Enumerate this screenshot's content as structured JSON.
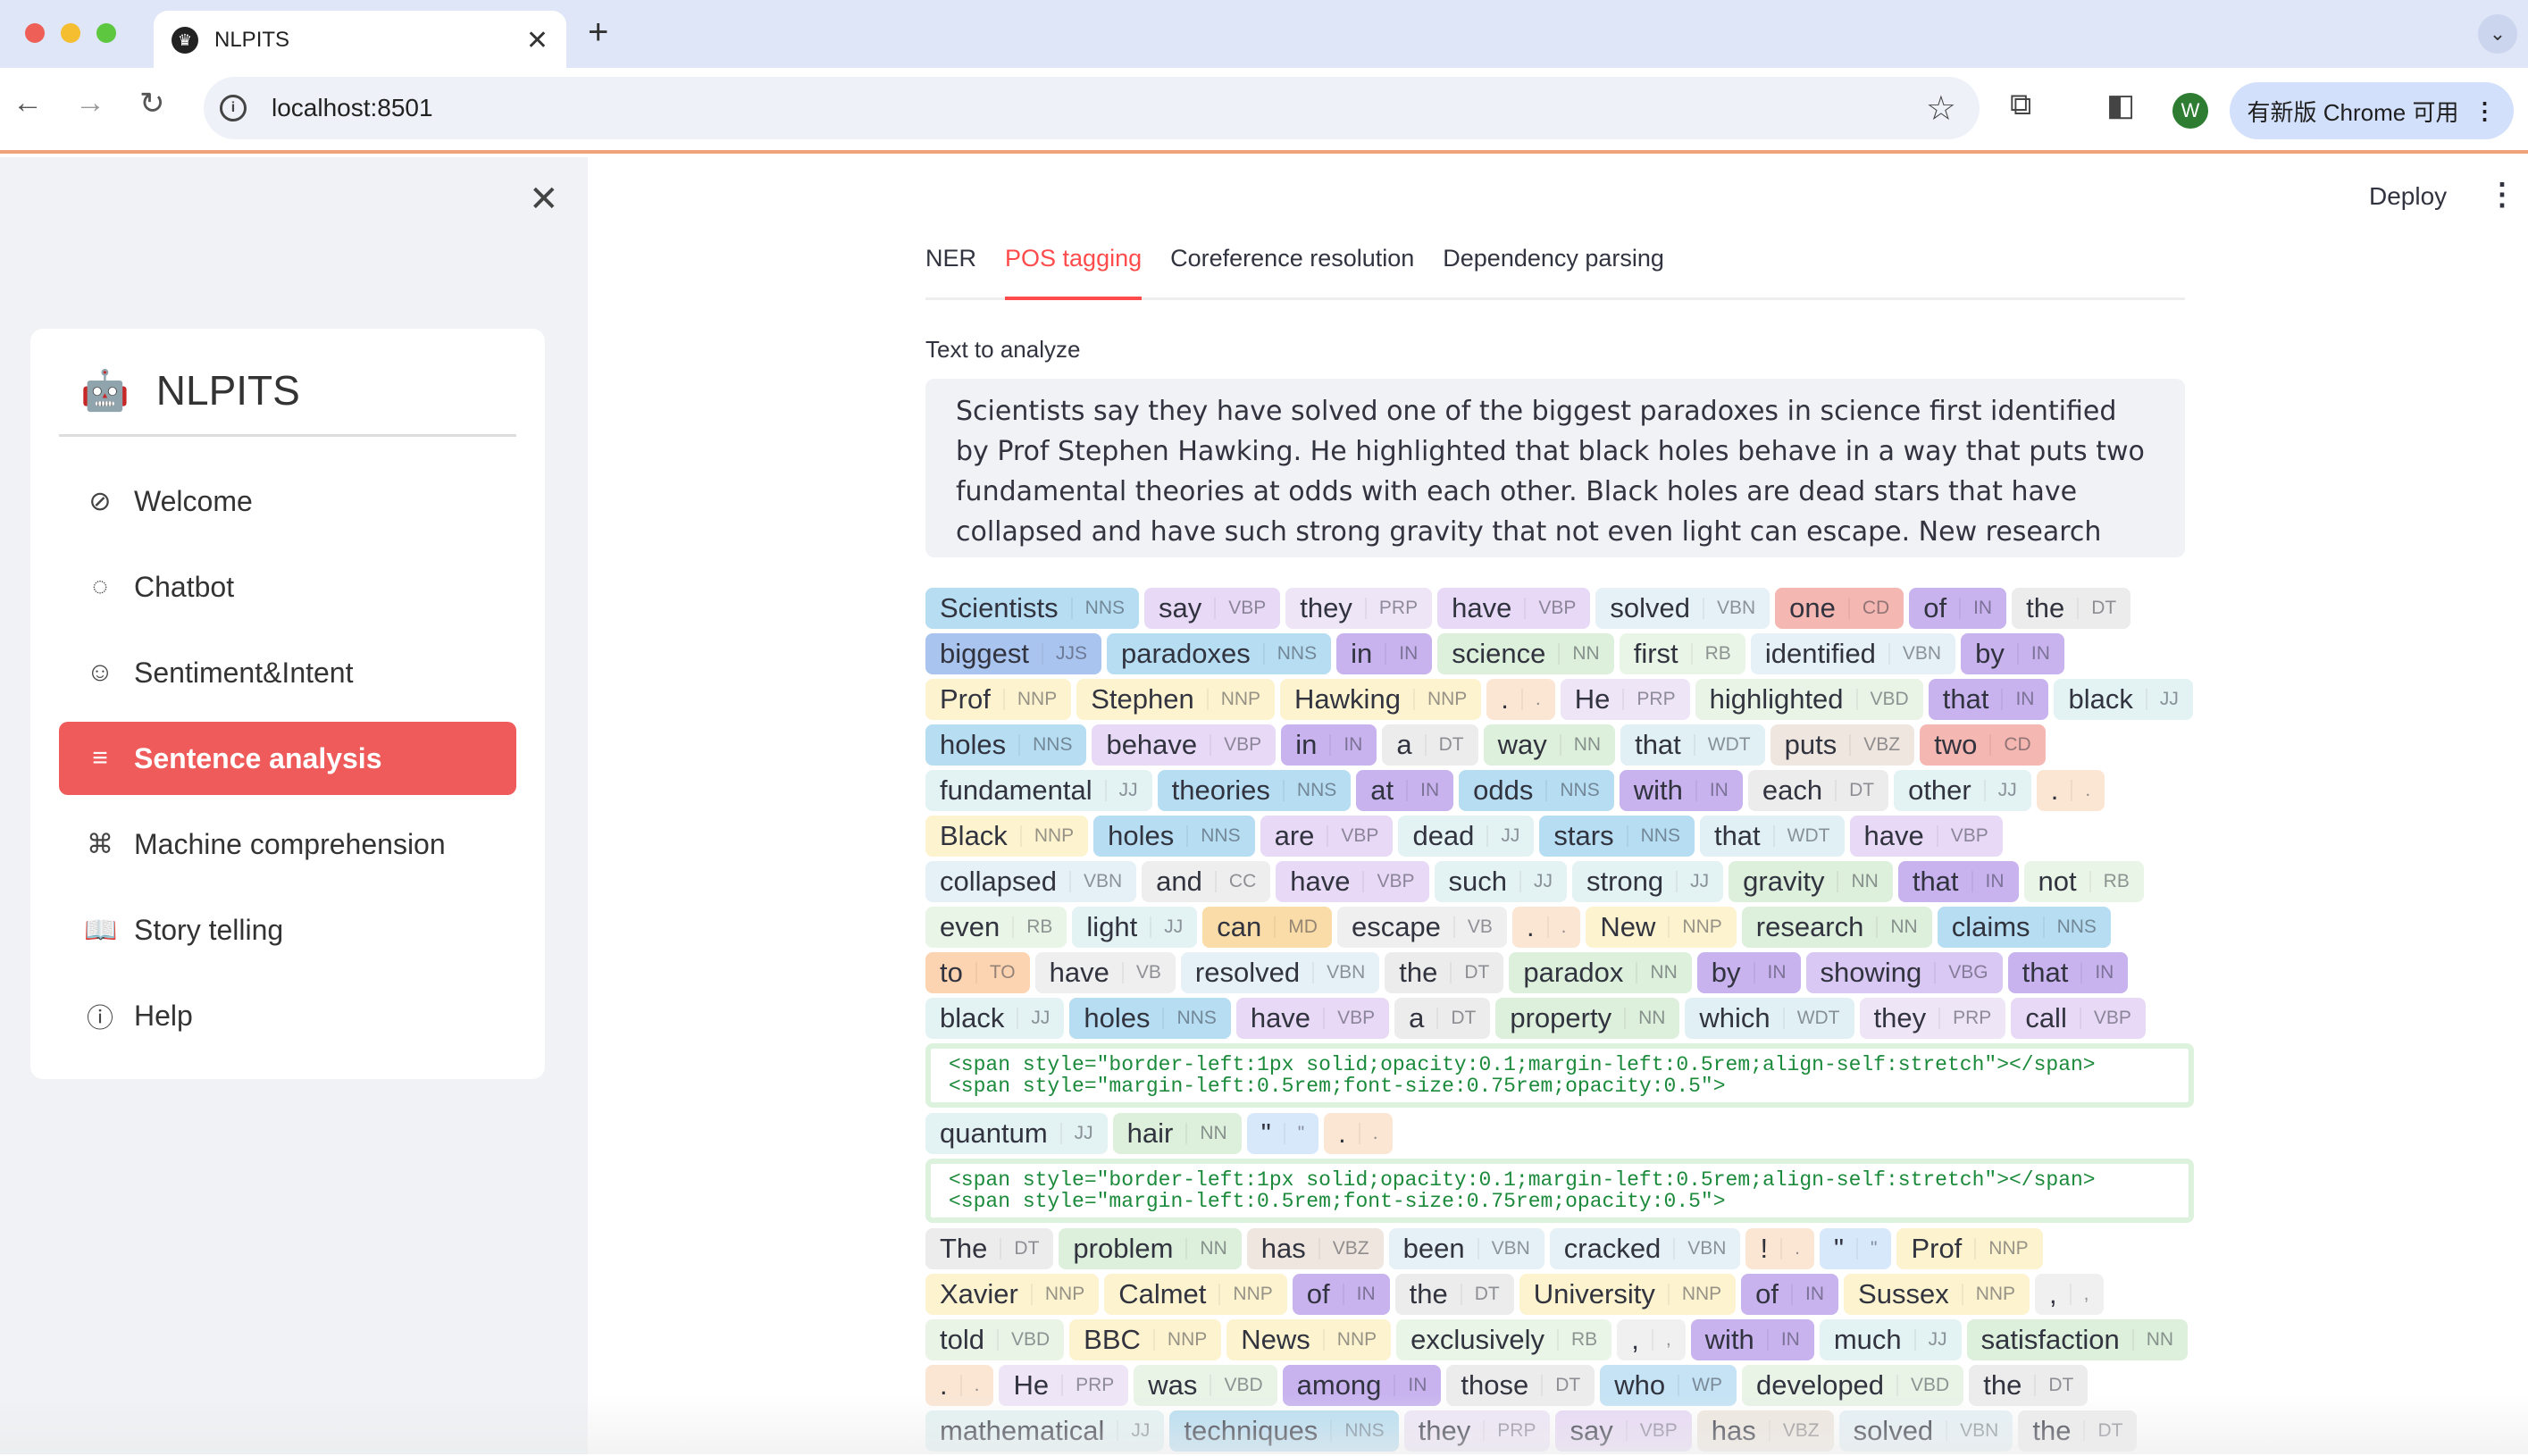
{
  "browser": {
    "tab_title": "NLPITS",
    "url": "localhost:8501",
    "update_label": "有新版 Chrome 可用",
    "avatar_letter": "W"
  },
  "app": {
    "deploy": "Deploy",
    "brand": "NLPITS",
    "menu": [
      {
        "label": "Welcome",
        "icon": "compass-icon"
      },
      {
        "label": "Chatbot",
        "icon": "chat-icon"
      },
      {
        "label": "Sentiment&Intent",
        "icon": "smile-icon"
      },
      {
        "label": "Sentence analysis",
        "icon": "list-icon",
        "active": true
      },
      {
        "label": "Machine comprehension",
        "icon": "translate-icon"
      },
      {
        "label": "Story telling",
        "icon": "book-icon"
      },
      {
        "label": "Help",
        "icon": "help-icon"
      }
    ],
    "tabs": [
      "NER",
      "POS tagging",
      "Coreference resolution",
      "Dependency parsing"
    ],
    "active_tab": "POS tagging",
    "text_label": "Text to analyze",
    "text_value": "Scientists say they have solved one of the biggest paradoxes in science first identified by Prof Stephen Hawking. He highlighted that black holes behave in a way that puts two fundamental theories at odds with each other. Black holes are dead stars that have collapsed and have such strong gravity that not even light can escape. New research claims to have resolved the paradox by",
    "code_block": "<span style=\"border-left:1px solid;opacity:0.1;margin-left:0.5rem;align-self:stretch\"></span>\n<span style=\"margin-left:0.5rem;font-size:0.75rem;opacity:0.5\">",
    "rows": [
      [
        [
          "Scientists",
          "NNS"
        ],
        [
          "say",
          "VBP"
        ],
        [
          "they",
          "PRP"
        ],
        [
          "have",
          "VBP"
        ],
        [
          "solved",
          "VBN"
        ],
        [
          "one",
          "CD"
        ],
        [
          "of",
          "IN"
        ],
        [
          "the",
          "DT"
        ]
      ],
      [
        [
          "biggest",
          "JJS"
        ],
        [
          "paradoxes",
          "NNS"
        ],
        [
          "in",
          "IN"
        ],
        [
          "science",
          "NN"
        ],
        [
          "first",
          "RB"
        ],
        [
          "identified",
          "VBN"
        ],
        [
          "by",
          "IN"
        ]
      ],
      [
        [
          "Prof",
          "NNP"
        ],
        [
          "Stephen",
          "NNP"
        ],
        [
          "Hawking",
          "NNP"
        ],
        [
          ".",
          "."
        ],
        [
          "He",
          "PRP"
        ],
        [
          "highlighted",
          "VBD"
        ],
        [
          "that",
          "IN"
        ],
        [
          "black",
          "JJ"
        ]
      ],
      [
        [
          "holes",
          "NNS"
        ],
        [
          "behave",
          "VBP"
        ],
        [
          "in",
          "IN"
        ],
        [
          "a",
          "DT"
        ],
        [
          "way",
          "NN"
        ],
        [
          "that",
          "WDT"
        ],
        [
          "puts",
          "VBZ"
        ],
        [
          "two",
          "CD"
        ]
      ],
      [
        [
          "fundamental",
          "JJ"
        ],
        [
          "theories",
          "NNS"
        ],
        [
          "at",
          "IN"
        ],
        [
          "odds",
          "NNS"
        ],
        [
          "with",
          "IN"
        ],
        [
          "each",
          "DT"
        ],
        [
          "other",
          "JJ"
        ],
        [
          ".",
          "."
        ]
      ],
      [
        [
          "Black",
          "NNP"
        ],
        [
          "holes",
          "NNS"
        ],
        [
          "are",
          "VBP"
        ],
        [
          "dead",
          "JJ"
        ],
        [
          "stars",
          "NNS"
        ],
        [
          "that",
          "WDT"
        ],
        [
          "have",
          "VBP"
        ]
      ],
      [
        [
          "collapsed",
          "VBN"
        ],
        [
          "and",
          "CC"
        ],
        [
          "have",
          "VBP"
        ],
        [
          "such",
          "JJ"
        ],
        [
          "strong",
          "JJ"
        ],
        [
          "gravity",
          "NN"
        ],
        [
          "that",
          "IN"
        ],
        [
          "not",
          "RB"
        ]
      ],
      [
        [
          "even",
          "RB"
        ],
        [
          "light",
          "JJ"
        ],
        [
          "can",
          "MD"
        ],
        [
          "escape",
          "VB"
        ],
        [
          ".",
          "."
        ],
        [
          "New",
          "NNP"
        ],
        [
          "research",
          "NN"
        ],
        [
          "claims",
          "NNS"
        ]
      ],
      [
        [
          "to",
          "TO"
        ],
        [
          "have",
          "VB"
        ],
        [
          "resolved",
          "VBN"
        ],
        [
          "the",
          "DT"
        ],
        [
          "paradox",
          "NN"
        ],
        [
          "by",
          "IN"
        ],
        [
          "showing",
          "VBG"
        ],
        [
          "that",
          "IN"
        ]
      ],
      [
        [
          "black",
          "JJ"
        ],
        [
          "holes",
          "NNS"
        ],
        [
          "have",
          "VBP"
        ],
        [
          "a",
          "DT"
        ],
        [
          "property",
          "NN"
        ],
        [
          "which",
          "WDT"
        ],
        [
          "they",
          "PRP"
        ],
        [
          "call",
          "VBP"
        ]
      ],
      "CODE",
      [
        [
          "quantum",
          "JJ"
        ],
        [
          "hair",
          "NN"
        ],
        [
          "\"",
          "\""
        ],
        [
          ".",
          "."
        ]
      ],
      "CODE",
      [
        [
          "The",
          "DT"
        ],
        [
          "problem",
          "NN"
        ],
        [
          "has",
          "VBZ"
        ],
        [
          "been",
          "VBN"
        ],
        [
          "cracked",
          "VBN"
        ],
        [
          "!",
          "."
        ],
        [
          "\"",
          "\""
        ],
        [
          "Prof",
          "NNP"
        ]
      ],
      [
        [
          "Xavier",
          "NNP"
        ],
        [
          "Calmet",
          "NNP"
        ],
        [
          "of",
          "IN"
        ],
        [
          "the",
          "DT"
        ],
        [
          "University",
          "NNP"
        ],
        [
          "of",
          "IN"
        ],
        [
          "Sussex",
          "NNP"
        ],
        [
          ",",
          ","
        ]
      ],
      [
        [
          "told",
          "VBD"
        ],
        [
          "BBC",
          "NNP"
        ],
        [
          "News",
          "NNP"
        ],
        [
          "exclusively",
          "RB"
        ],
        [
          ",",
          ","
        ],
        [
          "with",
          "IN"
        ],
        [
          "much",
          "JJ"
        ],
        [
          "satisfaction",
          "NN"
        ]
      ],
      [
        [
          ".",
          "."
        ],
        [
          "He",
          "PRP"
        ],
        [
          "was",
          "VBD"
        ],
        [
          "among",
          "IN"
        ],
        [
          "those",
          "DT"
        ],
        [
          "who",
          "WP"
        ],
        [
          "developed",
          "VBD"
        ],
        [
          "the",
          "DT"
        ]
      ],
      [
        [
          "mathematical",
          "JJ"
        ],
        [
          "techniques",
          "NNS"
        ],
        [
          "they",
          "PRP"
        ],
        [
          "say",
          "VBP"
        ],
        [
          "has",
          "VBZ"
        ],
        [
          "solved",
          "VBN"
        ],
        [
          "the",
          "DT"
        ]
      ]
    ]
  },
  "colors": {
    "accent": "#ff4b4b",
    "active_menu": "#ef5b5b",
    "sidebar_bg": "#f0f2f6"
  }
}
